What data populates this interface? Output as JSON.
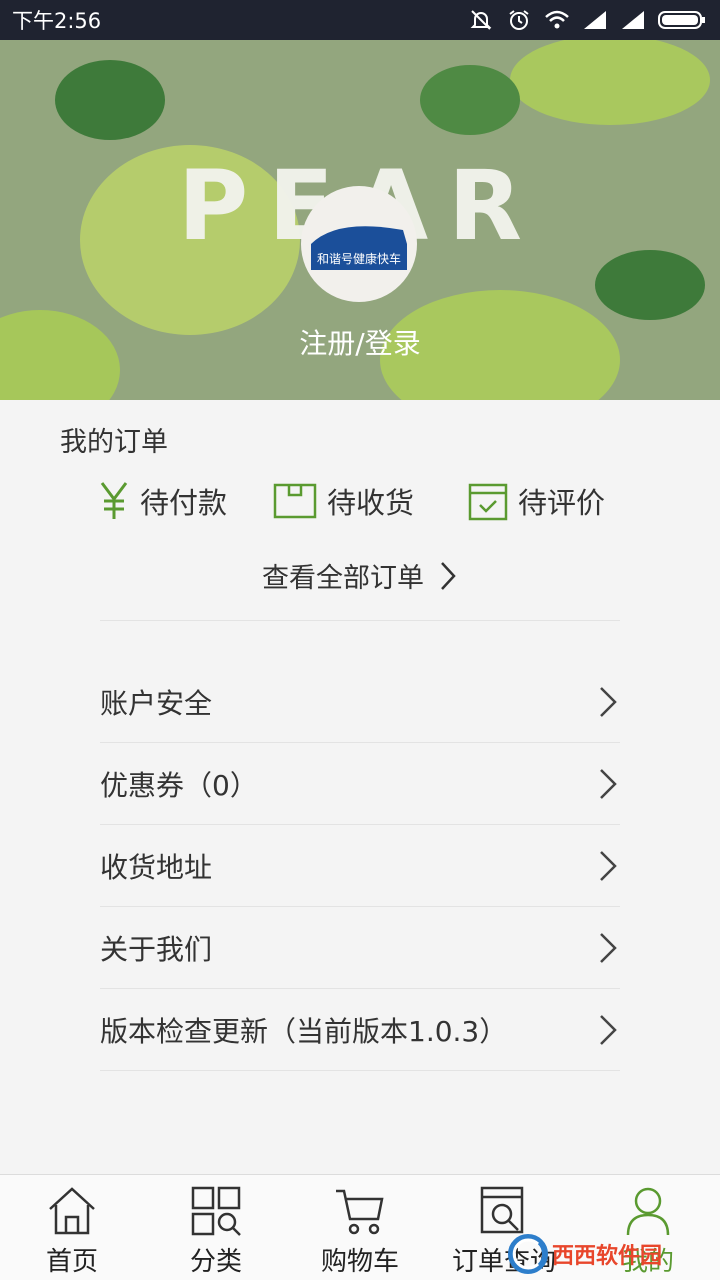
{
  "status_bar": {
    "time": "下午2:56"
  },
  "banner": {
    "word": "PEAR",
    "avatar_text": "和谐号健康快车",
    "login_label": "注册/登录"
  },
  "orders": {
    "title": "我的订单",
    "statuses": [
      {
        "label": "待付款",
        "icon": "yen-icon"
      },
      {
        "label": "待收货",
        "icon": "box-icon"
      },
      {
        "label": "待评价",
        "icon": "check-box-icon"
      }
    ],
    "view_all": "查看全部订单"
  },
  "menu": [
    {
      "label": "账户安全"
    },
    {
      "label": "优惠券（0）"
    },
    {
      "label": "收货地址"
    },
    {
      "label": "关于我们"
    },
    {
      "label": "版本检查更新（当前版本1.0.3）"
    }
  ],
  "bottom_nav": [
    {
      "label": "首页",
      "icon": "home-icon"
    },
    {
      "label": "分类",
      "icon": "category-icon"
    },
    {
      "label": "购物车",
      "icon": "cart-icon"
    },
    {
      "label": "订单查询",
      "icon": "order-search-icon"
    },
    {
      "label": "我的",
      "icon": "user-icon",
      "active": true
    }
  ],
  "watermark": {
    "text": "西西软件园"
  },
  "colors": {
    "accent_green": "#5a9a30",
    "status_bar": "#1f2330",
    "banner_green": "#8fa27a"
  }
}
